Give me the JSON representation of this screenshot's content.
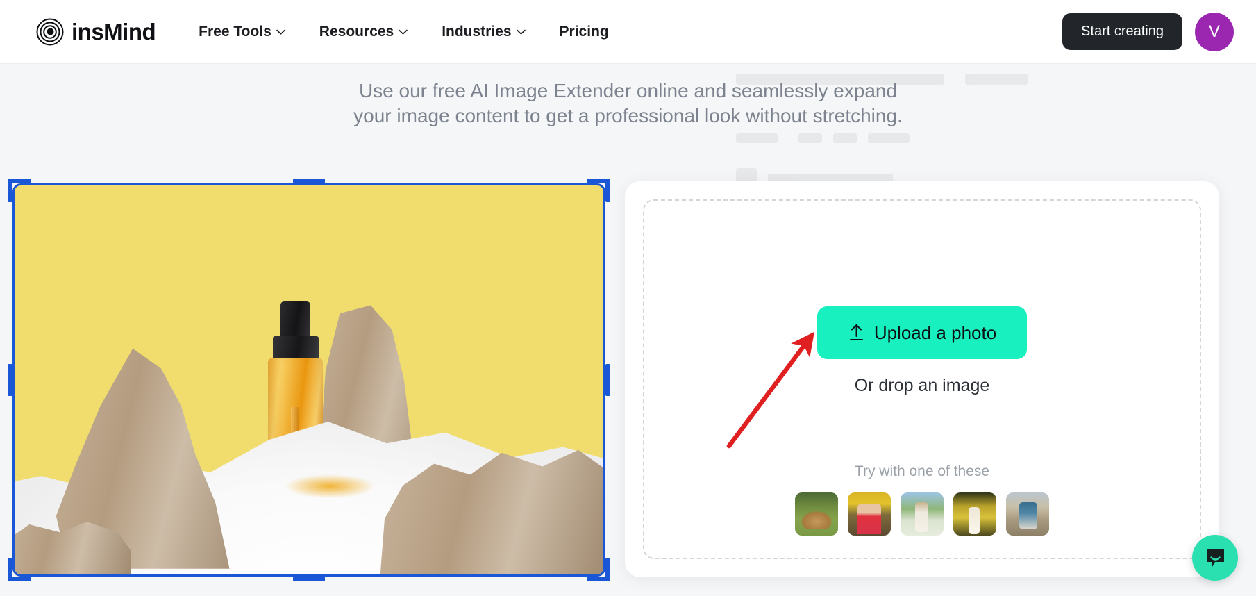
{
  "brand": {
    "name": "insMind",
    "logo_icon": "concentric-circles-logo"
  },
  "nav": {
    "items": [
      {
        "label": "Free Tools",
        "has_dropdown": true
      },
      {
        "label": "Resources",
        "has_dropdown": true
      },
      {
        "label": "Industries",
        "has_dropdown": true
      },
      {
        "label": "Pricing",
        "has_dropdown": false
      }
    ]
  },
  "header_actions": {
    "start_creating_label": "Start creating",
    "avatar_initial": "V",
    "avatar_color": "#9b27b0",
    "start_button_color": "#22262b"
  },
  "subtitle": {
    "line1": "Use our free AI Image Extender online and seamlessly expand",
    "line2": "your image content to get a professional look without stretching."
  },
  "canvas": {
    "selection_color": "#1a57d6",
    "image_description": "Amber dropper bottle on white sand with driftwood rocks, yellow background",
    "background_color": "#f0dd6e"
  },
  "upload": {
    "button_label": "Upload a photo",
    "button_icon": "upload-arrow-icon",
    "button_color": "#19f0c0",
    "drop_label": "Or drop an image",
    "try_label": "Try with one of these",
    "samples": [
      {
        "name": "golden-retriever-on-grass"
      },
      {
        "name": "girl-in-tulip-field"
      },
      {
        "name": "woman-in-daisy-meadow"
      },
      {
        "name": "child-in-yellow-flower-field"
      },
      {
        "name": "woman-sitting-on-rocks"
      }
    ]
  },
  "annotation": {
    "arrow_color": "#e02020",
    "points_to": "Upload a photo"
  },
  "chat": {
    "icon": "chat-bubble-smile-icon",
    "color": "#2ae0b0"
  }
}
